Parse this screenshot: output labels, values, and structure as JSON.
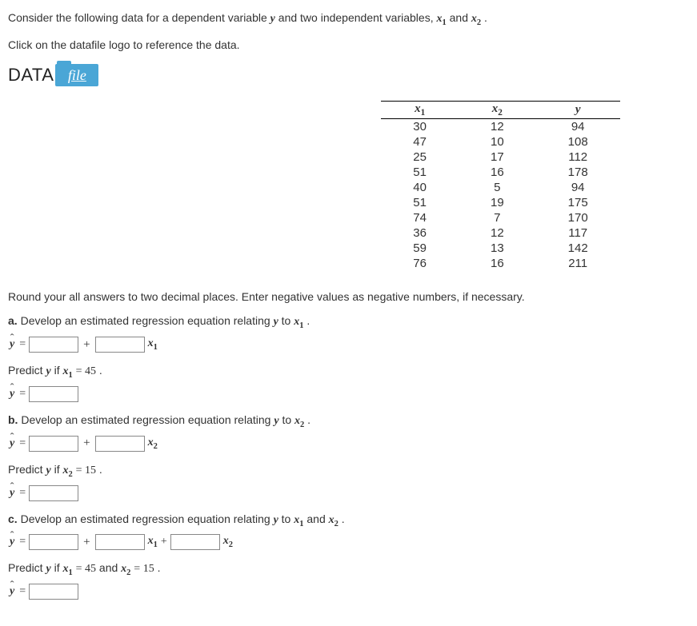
{
  "intro": {
    "line1_pre": "Consider the following data for a dependent variable ",
    "y": "y",
    "line1_mid": " and two independent variables, ",
    "x1": "x",
    "s1": "1",
    "and": " and ",
    "x2": "x",
    "s2": "2",
    "dot": ".",
    "line2": "Click on the datafile logo to reference the data."
  },
  "datafile": {
    "data_text": "DATA",
    "file_text": "file"
  },
  "table": {
    "headers": {
      "c1": "x",
      "c1s": "1",
      "c2": "x",
      "c2s": "2",
      "c3": "y"
    },
    "rows": [
      {
        "x1": "30",
        "x2": "12",
        "y": "94"
      },
      {
        "x1": "47",
        "x2": "10",
        "y": "108"
      },
      {
        "x1": "25",
        "x2": "17",
        "y": "112"
      },
      {
        "x1": "51",
        "x2": "16",
        "y": "178"
      },
      {
        "x1": "40",
        "x2": "5",
        "y": "94"
      },
      {
        "x1": "51",
        "x2": "19",
        "y": "175"
      },
      {
        "x1": "74",
        "x2": "7",
        "y": "170"
      },
      {
        "x1": "36",
        "x2": "12",
        "y": "117"
      },
      {
        "x1": "59",
        "x2": "13",
        "y": "142"
      },
      {
        "x1": "76",
        "x2": "16",
        "y": "211"
      }
    ]
  },
  "instructions": "Round your all answers to two decimal places. Enter negative values as negative numbers, if necessary.",
  "a": {
    "label": "a.",
    "text": " Develop an estimated regression equation relating ",
    "y": "y",
    "to": " to ",
    "x": "x",
    "s": "1",
    "dot": ".",
    "yhat": "y",
    "eq": " = ",
    "plus": "+",
    "term_x": "x",
    "term_s": "1",
    "predict_pre": "Predict ",
    "predict_y": "y",
    "predict_if": " if ",
    "px": "x",
    "ps": "1",
    "peq": " = 45",
    "pdot": ".",
    "result_yhat": "y",
    "result_eq": " = "
  },
  "b": {
    "label": "b.",
    "text": " Develop an estimated regression equation relating ",
    "y": "y",
    "to": " to ",
    "x": "x",
    "s": "2",
    "dot": ".",
    "yhat": "y",
    "eq": " = ",
    "plus": "+",
    "term_x": "x",
    "term_s": "2",
    "predict_pre": "Predict ",
    "predict_y": "y",
    "predict_if": " if ",
    "px": "x",
    "ps": "2",
    "peq": " = 15",
    "pdot": ".",
    "result_yhat": "y",
    "result_eq": " = "
  },
  "c": {
    "label": "c.",
    "text": " Develop an estimated regression equation relating ",
    "y": "y",
    "to": " to ",
    "x1": "x",
    "s1": "1",
    "and": " and ",
    "x2": "x",
    "s2": "2",
    "dot": ".",
    "yhat": "y",
    "eq": " = ",
    "plus": "+",
    "t1x": "x",
    "t1s": "1",
    "mid_plus": " + ",
    "t2x": "x",
    "t2s": "2",
    "predict_pre": "Predict ",
    "predict_y": "y",
    "predict_if": " if ",
    "p1x": "x",
    "p1s": "1",
    "p1eq": " = 45",
    "pand": " and ",
    "p2x": "x",
    "p2s": "2",
    "p2eq": " = 15",
    "pdot": ".",
    "result_yhat": "y",
    "result_eq": " = "
  }
}
